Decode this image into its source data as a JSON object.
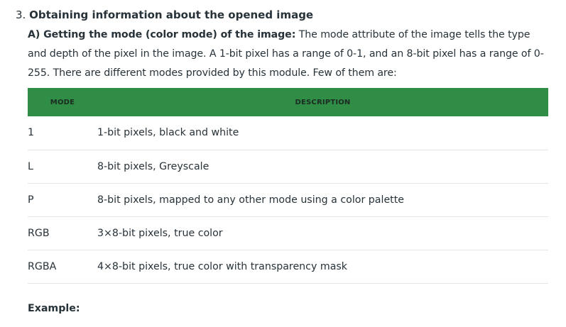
{
  "section": {
    "number": "3.",
    "title": "Obtaining information about the opened image"
  },
  "subsection": {
    "title": "A) Getting the mode (color mode) of the image:",
    "body": " The mode attribute of the image tells the type and depth of the pixel in the image. A 1-bit pixel has a range of 0-1, and an 8-bit pixel has a range of 0-255. There are different modes provided by this module. Few of them are:"
  },
  "table": {
    "header_color": "#2f8d46",
    "columns": [
      "MODE",
      "DESCRIPTION"
    ],
    "rows": [
      {
        "mode": "1",
        "description": "1-bit pixels, black and white"
      },
      {
        "mode": "L",
        "description": "8-bit pixels, Greyscale"
      },
      {
        "mode": "P",
        "description": "8-bit pixels, mapped to any other mode using a color palette"
      },
      {
        "mode": "RGB",
        "description": "3×8-bit pixels, true color"
      },
      {
        "mode": "RGBA",
        "description": "4×8-bit pixels, true color with transparency mask"
      }
    ]
  },
  "example_label": "Example:"
}
